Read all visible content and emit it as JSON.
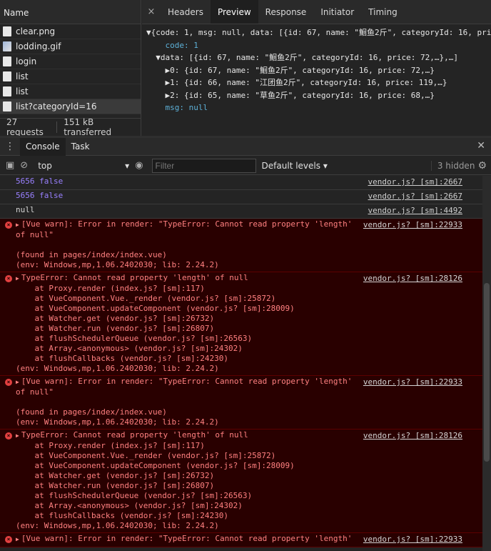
{
  "network": {
    "name_header": "Name",
    "files": [
      {
        "name": "clear.png",
        "icon": "doc"
      },
      {
        "name": "lodding.gif",
        "icon": "img"
      },
      {
        "name": "login",
        "icon": "doc"
      },
      {
        "name": "list",
        "icon": "doc"
      },
      {
        "name": "list",
        "icon": "doc"
      },
      {
        "name": "list?categoryId=16",
        "icon": "doc"
      }
    ],
    "requests": "27 requests",
    "transferred": "151 kB transferred"
  },
  "detail": {
    "close": "×",
    "tabs": [
      "Headers",
      "Preview",
      "Response",
      "Initiator",
      "Timing"
    ],
    "active_tab": "Preview",
    "preview_lines": [
      "▼{code: 1, msg: null, data: [{id: 67, name: \"鮰鱼2斤\", categoryId: 16, pri",
      "    code: 1",
      "  ▼data: [{id: 67, name: \"鮰鱼2斤\", categoryId: 16, price: 72,…},…]",
      "    ▶0: {id: 67, name: \"鮰鱼2斤\", categoryId: 16, price: 72,…}",
      "    ▶1: {id: 66, name: \"江团鱼2斤\", categoryId: 16, price: 119,…}",
      "    ▶2: {id: 65, name: \"草鱼2斤\", categoryId: 16, price: 68,…}",
      "    msg: null"
    ]
  },
  "drawer": {
    "tabs": [
      "Console",
      "Task"
    ],
    "active_tab": "Console",
    "context": "top",
    "filter_placeholder": "Filter",
    "levels": "Default levels",
    "hidden": "3 hidden"
  },
  "console": {
    "entries": [
      {
        "type": "plain",
        "num": "5656",
        "text": " false",
        "src": "vendor.js? [sm]:2667"
      },
      {
        "type": "plain",
        "num": "5656",
        "text": " false",
        "src": "vendor.js? [sm]:2667"
      },
      {
        "type": "plain",
        "num": "",
        "text": "null",
        "src": "vendor.js? [sm]:4492"
      },
      {
        "type": "err",
        "text": "[Vue warn]: Error in render: \"TypeError: Cannot read property 'length'\nof null\"\n\n(found in pages/index/index.vue)\n(env: Windows,mp,1.06.2402030; lib: 2.24.2)",
        "src": "vendor.js? [sm]:22933"
      },
      {
        "type": "err",
        "text": "TypeError: Cannot read property 'length' of null\n    at Proxy.render (index.js? [sm]:117)\n    at VueComponent.Vue._render (vendor.js? [sm]:25872)\n    at VueComponent.updateComponent (vendor.js? [sm]:28009)\n    at Watcher.get (vendor.js? [sm]:26732)\n    at Watcher.run (vendor.js? [sm]:26807)\n    at flushSchedulerQueue (vendor.js? [sm]:26563)\n    at Array.<anonymous> (vendor.js? [sm]:24302)\n    at flushCallbacks (vendor.js? [sm]:24230)\n(env: Windows,mp,1.06.2402030; lib: 2.24.2)",
        "src": "vendor.js? [sm]:28126"
      },
      {
        "type": "err",
        "text": "[Vue warn]: Error in render: \"TypeError: Cannot read property 'length'\nof null\"\n\n(found in pages/index/index.vue)\n(env: Windows,mp,1.06.2402030; lib: 2.24.2)",
        "src": "vendor.js? [sm]:22933"
      },
      {
        "type": "err",
        "text": "TypeError: Cannot read property 'length' of null\n    at Proxy.render (index.js? [sm]:117)\n    at VueComponent.Vue._render (vendor.js? [sm]:25872)\n    at VueComponent.updateComponent (vendor.js? [sm]:28009)\n    at Watcher.get (vendor.js? [sm]:26732)\n    at Watcher.run (vendor.js? [sm]:26807)\n    at flushSchedulerQueue (vendor.js? [sm]:26563)\n    at Array.<anonymous> (vendor.js? [sm]:24302)\n    at flushCallbacks (vendor.js? [sm]:24230)\n(env: Windows,mp,1.06.2402030; lib: 2.24.2)",
        "src": "vendor.js? [sm]:28126"
      },
      {
        "type": "err",
        "text": "[Vue warn]: Error in render: \"TypeError: Cannot read property 'length'",
        "src": "vendor.js? [sm]:22933"
      }
    ]
  },
  "colors": {
    "error_bg": "#290000",
    "error_text": "#ff8080",
    "key": "#5db0d7",
    "string": "#f29766",
    "number": "#9980ff"
  }
}
